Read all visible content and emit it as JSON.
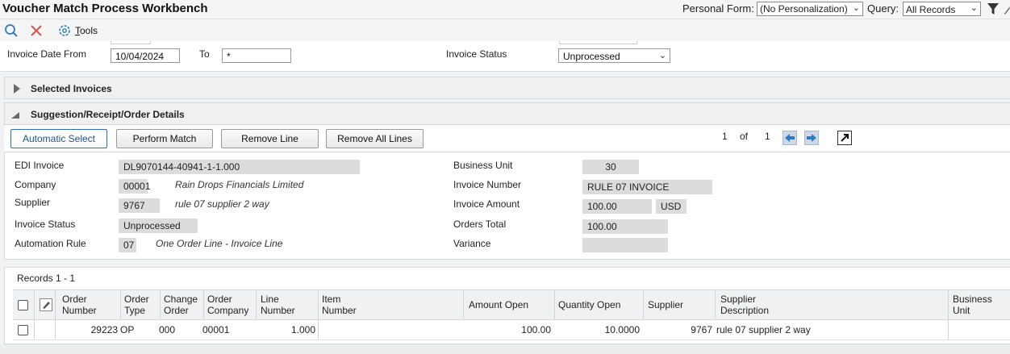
{
  "header": {
    "title": "Voucher Match Process Workbench",
    "personal_form_label": "Personal Form:",
    "personal_form_value": "(No Personalization)",
    "query_label": "Query:",
    "query_value": "All Records"
  },
  "toolbar": {
    "tools_label_first": "T",
    "tools_label_rest": "ools"
  },
  "filters": {
    "invoice_date_from_label": "Invoice Date From",
    "invoice_date_from_value": "10/04/2024",
    "to_label": "To",
    "to_value": "*",
    "invoice_status_label": "Invoice Status",
    "invoice_status_value": "Unprocessed"
  },
  "sections": {
    "selected_invoices": "Selected Invoices",
    "suggestion_details": "Suggestion/Receipt/Order Details"
  },
  "buttons": {
    "automatic_select": "Automatic Select",
    "perform_match": "Perform Match",
    "remove_line": "Remove Line",
    "remove_all_lines": "Remove All Lines"
  },
  "pagination": {
    "current": "1",
    "of": "of",
    "total": "1"
  },
  "details": {
    "edi_invoice_label": "EDI Invoice",
    "edi_invoice_value": "DL9070144-40941-1-1.000",
    "company_label": "Company",
    "company_value": "00001",
    "company_desc": "Rain Drops Financials Limited",
    "supplier_label": "Supplier",
    "supplier_value": "9767",
    "supplier_desc": "rule 07 supplier 2 way",
    "invoice_status_label": "Invoice Status",
    "invoice_status_value": "Unprocessed",
    "automation_rule_label": "Automation Rule",
    "automation_rule_value": "07",
    "automation_rule_desc": "One Order Line - Invoice Line",
    "business_unit_label": "Business Unit",
    "business_unit_value": "30",
    "invoice_number_label": "Invoice Number",
    "invoice_number_value": "RULE 07 INVOICE",
    "invoice_amount_label": "Invoice Amount",
    "invoice_amount_value": "100.00",
    "invoice_currency": "USD",
    "orders_total_label": "Orders Total",
    "orders_total_value": "100.00",
    "variance_label": "Variance",
    "variance_value": ""
  },
  "grid": {
    "records_label": "Records 1 - 1",
    "headers": {
      "order_number": [
        "Order",
        "Number"
      ],
      "order_type": [
        "Order",
        "Type"
      ],
      "change_order": [
        "Change",
        "Order"
      ],
      "order_company": [
        "Order",
        "Company"
      ],
      "line_number": [
        "Line",
        "Number"
      ],
      "item_number": [
        "Item",
        "Number"
      ],
      "amount_open": "Amount Open",
      "quantity_open": "Quantity Open",
      "supplier": "Supplier",
      "supplier_description": [
        "Supplier",
        "Description"
      ],
      "business_unit": [
        "Business",
        "Unit"
      ]
    },
    "rows": [
      {
        "order_number": "29223",
        "order_type": "OP",
        "change_order": "000",
        "order_company": "00001",
        "line_number": "1.000",
        "item_number": "",
        "amount_open": "100.00",
        "quantity_open": "10.0000",
        "supplier": "9767",
        "supplier_description": "rule 07 supplier 2 way",
        "business_unit": ""
      }
    ]
  }
}
